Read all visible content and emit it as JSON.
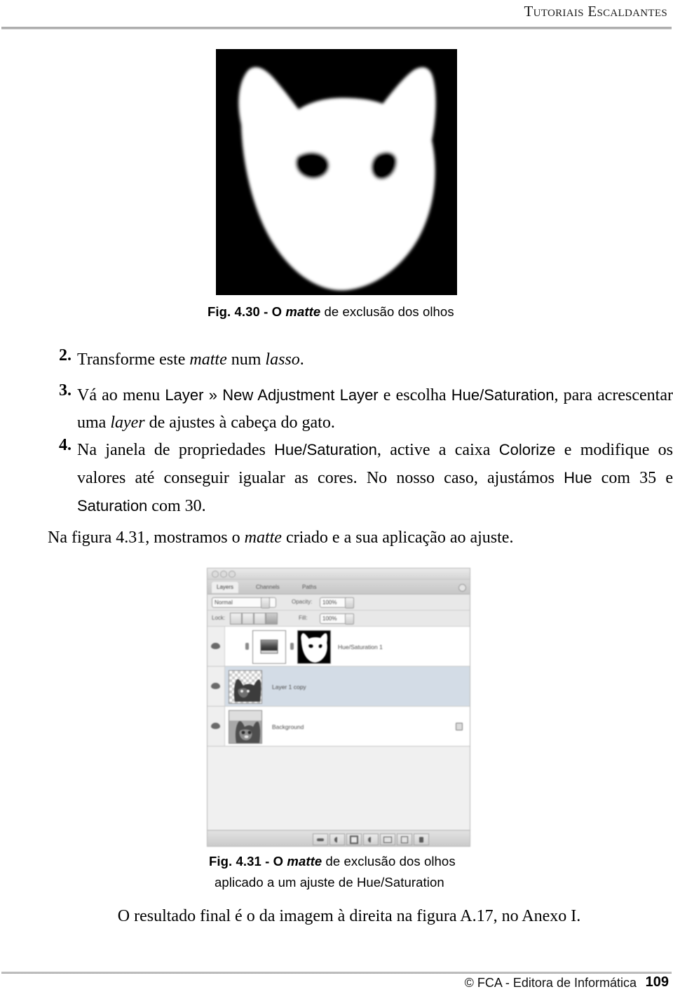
{
  "header": {
    "title": "Tutoriais Escaldantes"
  },
  "figure_430": {
    "image_alt": "cat-head-matte",
    "caption_prefix": "Fig. 4.30 - O ",
    "caption_italic": "matte",
    "caption_suffix": " de exclusão dos olhos"
  },
  "list": [
    {
      "number": "2.",
      "text_1": "Transforme este ",
      "italic_1": "matte",
      "text_2": " num ",
      "italic_2": "lasso",
      "text_3": "."
    },
    {
      "number": "3.",
      "text_1": "Vá ao menu ",
      "ui_1": "Layer » New Adjustment Layer",
      "text_2": " e escolha ",
      "ui_2": "Hue/Saturation",
      "text_3": ", para acrescentar uma ",
      "italic_1": "layer",
      "text_4": " de ajustes à cabeça do gato."
    },
    {
      "number": "4.",
      "text_1": "Na janela de propriedades ",
      "ui_1": "Hue/Saturation",
      "text_2": ", active a caixa ",
      "ui_2": "Colorize",
      "text_3": " e modifique os valores até conseguir igualar as cores. No nosso caso, ajustámos ",
      "ui_3": "Hue",
      "text_4": " com 35 e ",
      "ui_4": "Saturation",
      "text_5": " com 30."
    }
  ],
  "paragraph_fig431": {
    "text_1": "Na figura 4.31, mostramos o ",
    "italic_1": "matte",
    "text_2": " criado e a sua aplicação ao ajuste."
  },
  "photoshop_panel": {
    "tabs": [
      {
        "label": "Layers",
        "active": true
      },
      {
        "label": "Channels",
        "active": false
      },
      {
        "label": "Paths",
        "active": false
      }
    ],
    "blend_mode": "Normal",
    "opacity_label": "Opacity:",
    "opacity_value": "100%",
    "lock_label": "Lock:",
    "fill_label": "Fill:",
    "fill_value": "100%",
    "lock_buttons": [
      "lock-transparent-pixels",
      "lock-image-pixels",
      "lock-position",
      "lock-all"
    ],
    "layers": [
      {
        "name": "Hue/Saturation 1",
        "thumb": "adjustment-gradient",
        "mask_thumb": "cat-head-matte",
        "selected": true,
        "locked": false
      },
      {
        "name": "Layer 1 copy",
        "thumb": "cat-cutout-transparent",
        "selected": false,
        "locked": false
      },
      {
        "name": "Background",
        "thumb": "cat-photo",
        "selected": false,
        "locked": true
      }
    ],
    "bottom_tools": [
      "link-layers-icon",
      "layer-style-icon",
      "layer-mask-icon",
      "new-adjustment-layer-icon",
      "new-group-icon",
      "new-layer-icon",
      "delete-layer-icon"
    ]
  },
  "figure_431": {
    "caption_line1_prefix": "Fig. 4.31 - O ",
    "caption_line1_italic": "matte",
    "caption_line1_suffix": " de exclusão dos olhos",
    "caption_line2": "aplicado a um ajuste de Hue/Saturation"
  },
  "paragraph_final": {
    "text": "O resultado final é o da imagem à direita na figura A.17, no Anexo I."
  },
  "footer": {
    "text": "© FCA - Editora de Informática",
    "page_number": "109"
  },
  "colors": {
    "matte_background": "#000000",
    "matte_foreground": "#ffffff",
    "rule_gray": "#9a9a9a",
    "panel_chrome": "#e8e8e8"
  }
}
